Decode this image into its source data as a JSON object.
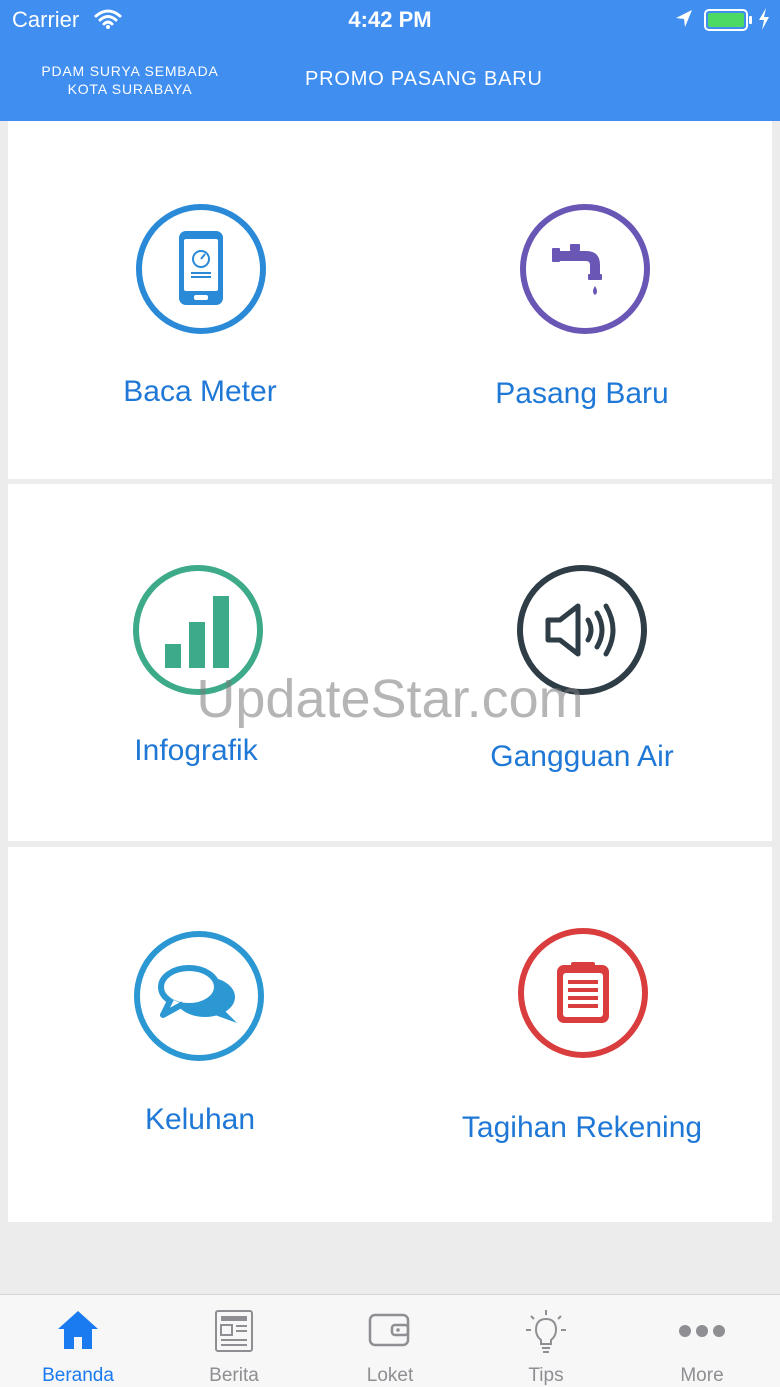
{
  "status_bar": {
    "carrier": "Carrier",
    "time": "4:42 PM"
  },
  "nav": {
    "left_title_line1": "PDAM SURYA SEMBADA",
    "left_title_line2": "KOTA SURABAYA",
    "right_title": "PROMO PASANG BARU"
  },
  "menu": [
    {
      "label": "Baca Meter",
      "icon": "phone-meter-icon",
      "color": "#2a8ad8"
    },
    {
      "label": "Pasang Baru",
      "icon": "faucet-icon",
      "color": "#6a56b4"
    },
    {
      "label": "Infografik",
      "icon": "bar-chart-icon",
      "color": "#3daa8a"
    },
    {
      "label": "Gangguan Air",
      "icon": "speaker-icon",
      "color": "#2f3d47"
    },
    {
      "label": "Keluhan",
      "icon": "chat-bubbles-icon",
      "color": "#2b97d3"
    },
    {
      "label": "Tagihan Rekening",
      "icon": "clipboard-icon",
      "color": "#d93d3d"
    }
  ],
  "watermark": "UpdateStar.com",
  "tabs": [
    {
      "label": "Beranda",
      "icon": "home-icon",
      "active": true
    },
    {
      "label": "Berita",
      "icon": "newspaper-icon",
      "active": false
    },
    {
      "label": "Loket",
      "icon": "wallet-icon",
      "active": false
    },
    {
      "label": "Tips",
      "icon": "lightbulb-icon",
      "active": false
    },
    {
      "label": "More",
      "icon": "more-dots-icon",
      "active": false
    }
  ],
  "colors": {
    "header": "#3f8ef0",
    "label_blue": "#1f78d6",
    "tab_active": "#1a7af0",
    "tab_inactive": "#8e8e93"
  }
}
